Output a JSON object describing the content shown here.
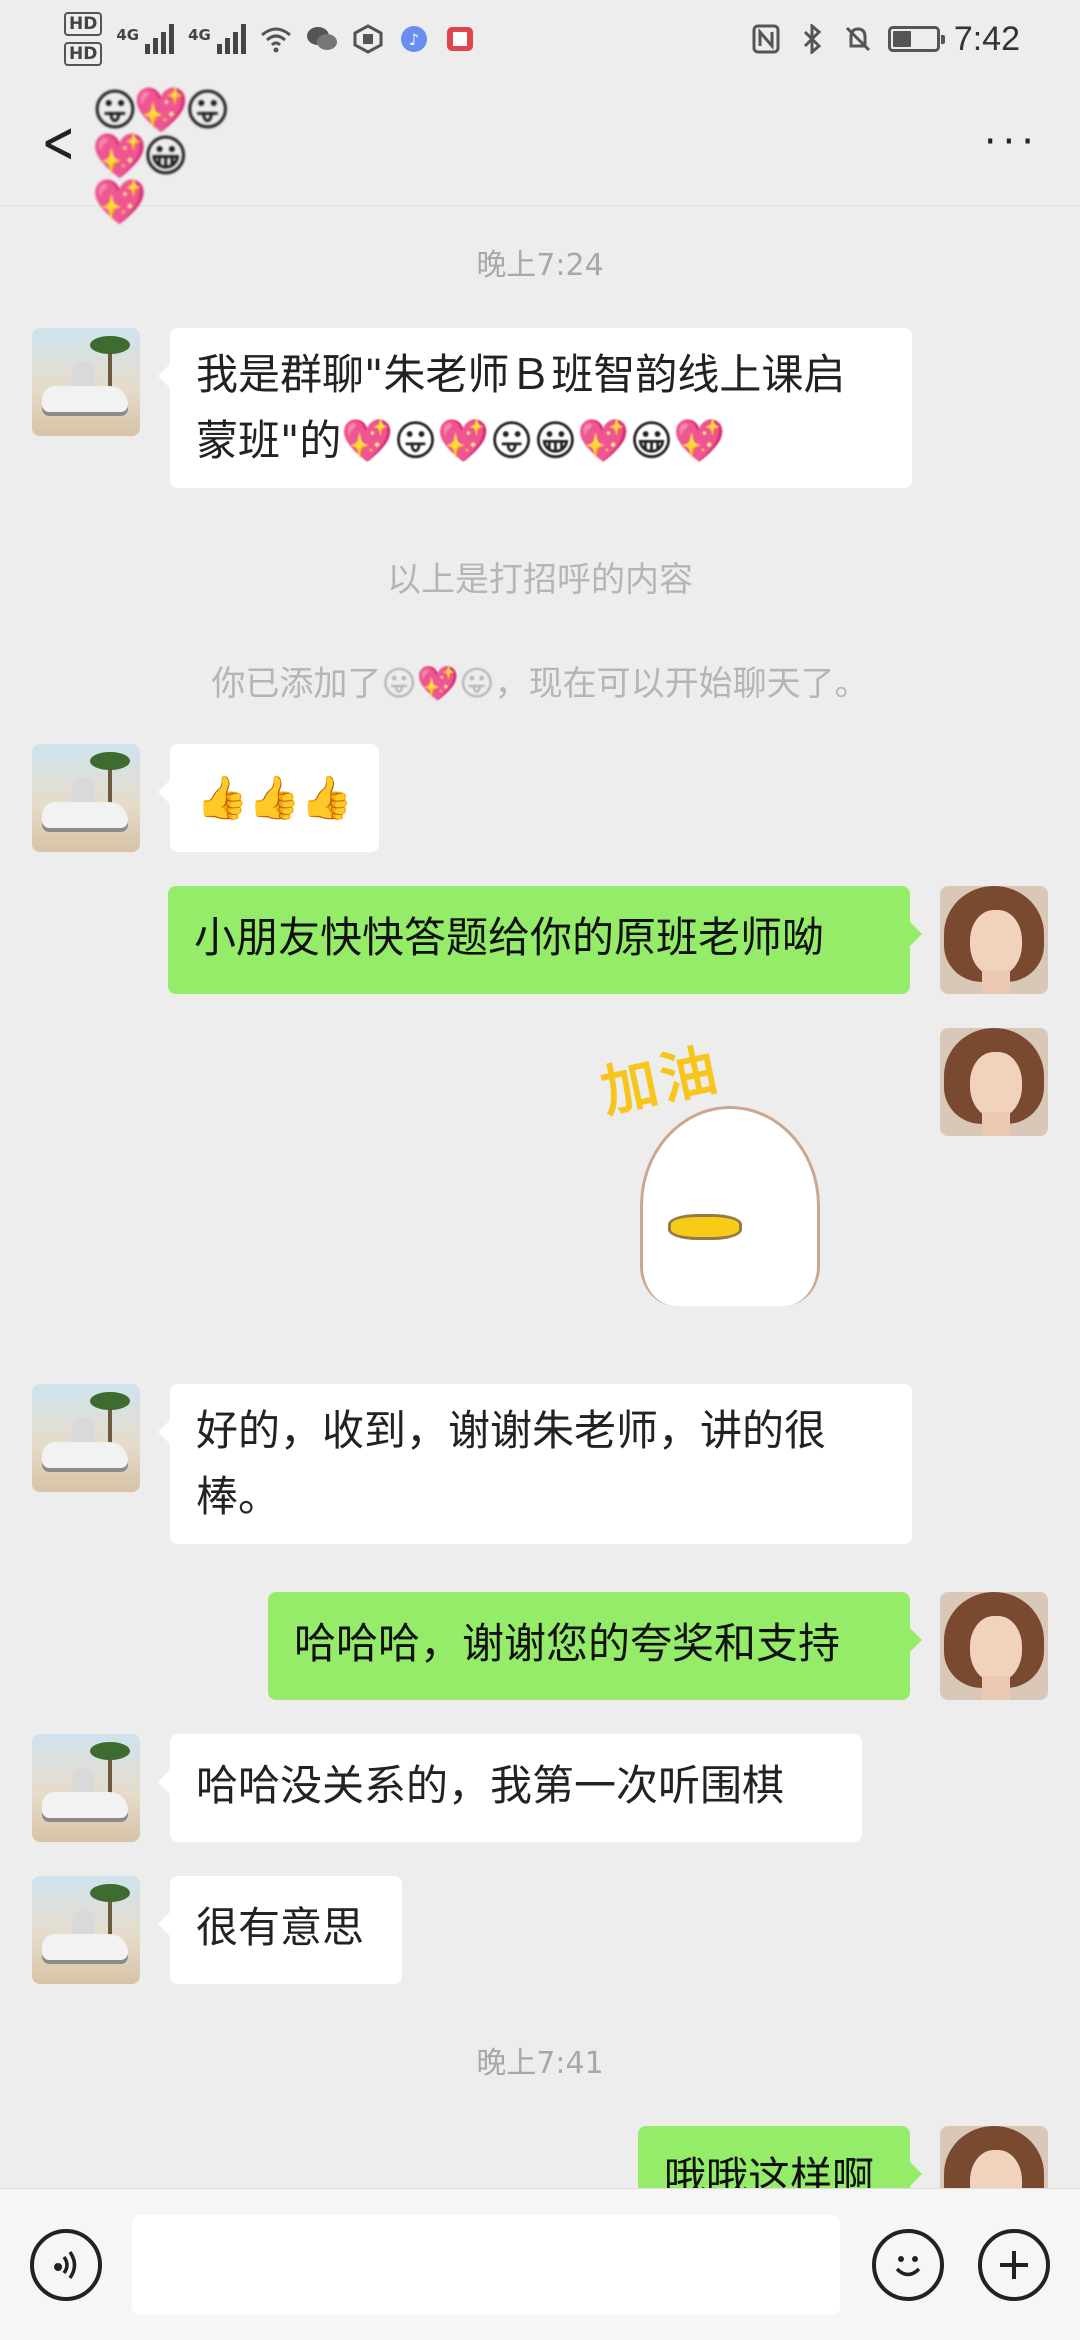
{
  "status_bar": {
    "hd1": "HD",
    "hd2": "HD",
    "net1": "4G",
    "net2": "4G",
    "time": "7:42"
  },
  "header": {
    "title_emoji": "😛💖😛💖😀💖",
    "more_label": "···",
    "back_label": "<"
  },
  "messages": {
    "ts1": "晚上7:24",
    "m1": "我是群聊\"朱老师Ｂ班智韵线上课启蒙班\"的",
    "m1_emoji": "💖😛💖😛😀💖😀💖",
    "sys1": "以上是打招呼的内容",
    "sys2_pre": "你已添加了",
    "sys2_emoji": "😛💖😛",
    "sys2_post": "，现在可以开始聊天了。",
    "m2": "👍👍👍",
    "m3": "小朋友快快答题给你的原班老师呦",
    "sticker_text": "加油",
    "m4": "好的，收到，谢谢朱老师，讲的很棒。",
    "m5": "哈哈哈，谢谢您的夸奖和支持",
    "m6": "哈哈没关系的，我第一次听围棋",
    "m7": "很有意思",
    "ts2": "晚上7:41",
    "m8": "哦哦这样啊"
  },
  "input_bar": {
    "voice_icon_label": "🔊",
    "emoji_icon_label": "☺",
    "plus_icon_label": "+",
    "message_value": ""
  }
}
